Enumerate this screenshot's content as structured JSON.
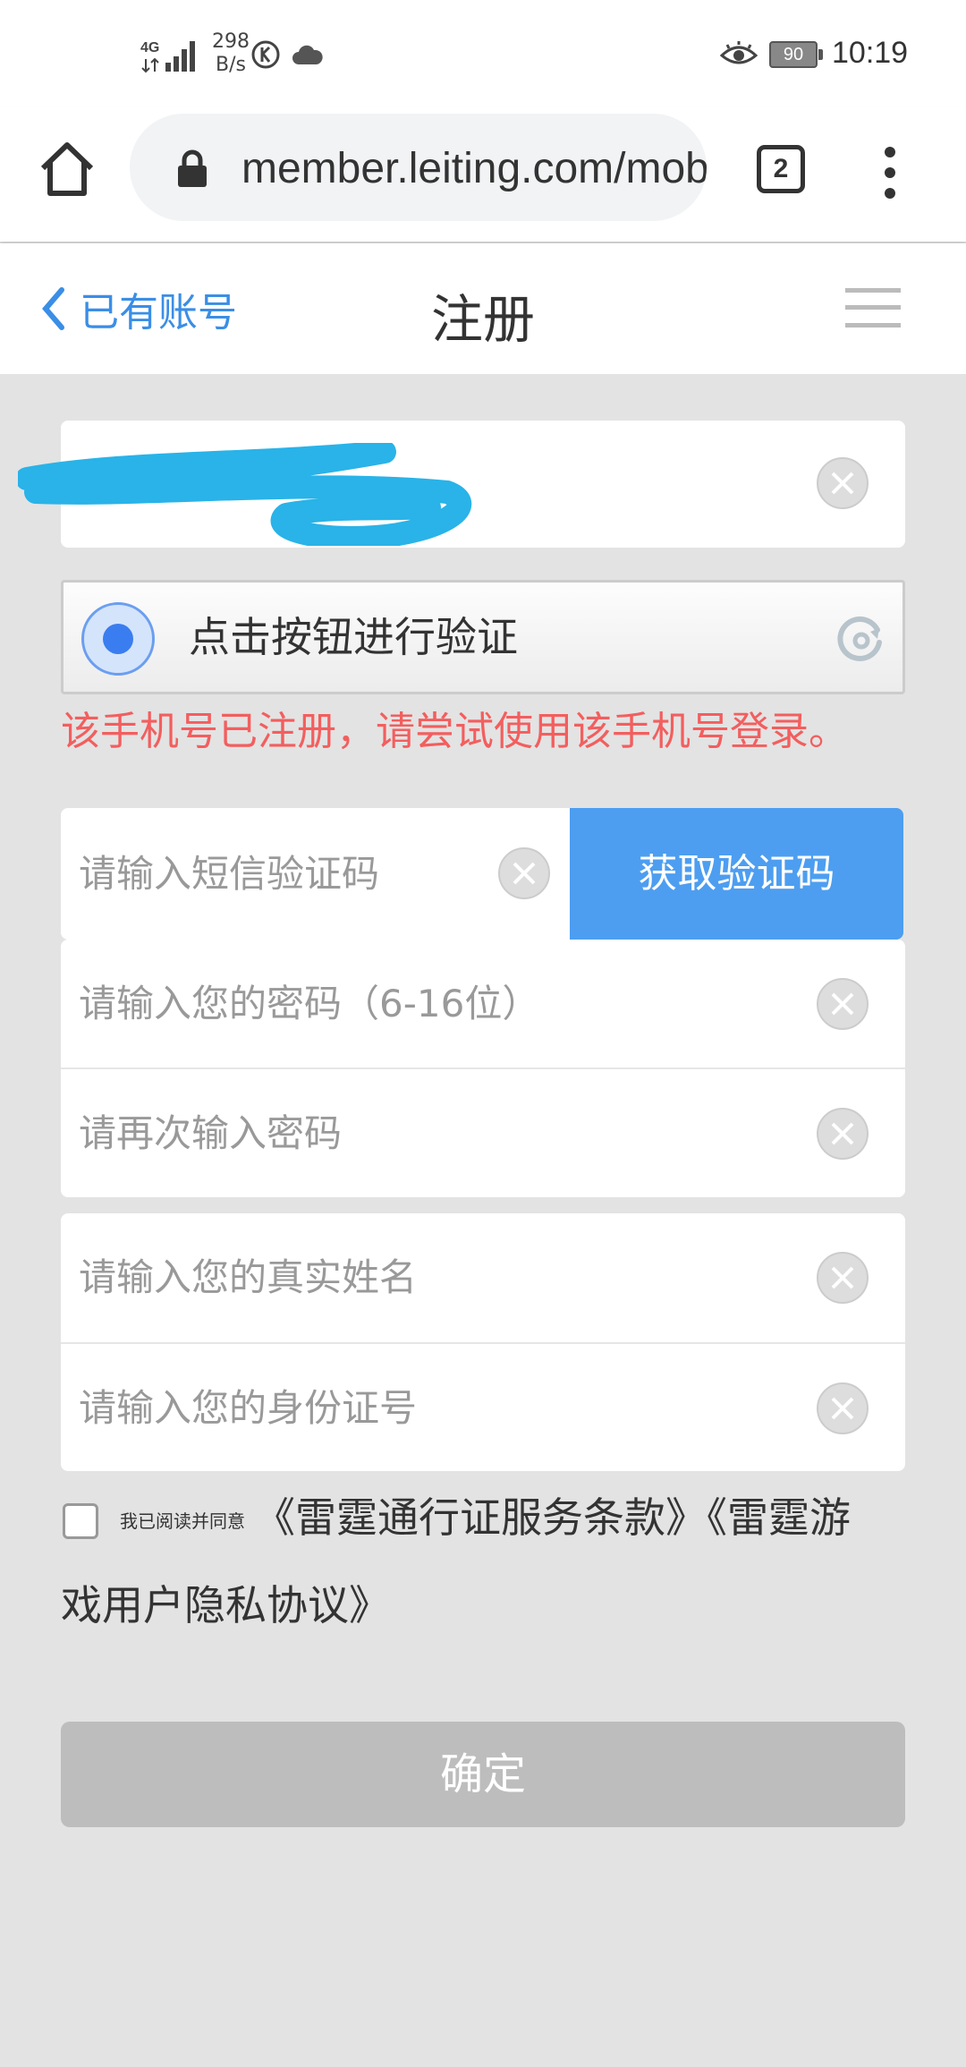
{
  "status_bar": {
    "network": "4G",
    "speed_value": "298",
    "speed_unit": "B/s",
    "battery": "90",
    "time": "10:19"
  },
  "browser": {
    "url": "member.leiting.com/mobile/register",
    "tab_count": "2"
  },
  "header": {
    "back_label": "已有账号",
    "title": "注册"
  },
  "captcha": {
    "label": "点击按钮进行验证"
  },
  "error_message": "该手机号已注册，请尝试使用该手机号登录。",
  "form": {
    "sms_placeholder": "请输入短信验证码",
    "sms_button": "获取验证码",
    "password_placeholder": "请输入您的密码（6-16位）",
    "password_confirm_placeholder": "请再次输入密码",
    "real_name_placeholder": "请输入您的真实姓名",
    "id_number_placeholder": "请输入您的身份证号"
  },
  "agreement": {
    "prefix": "我已阅读并同意",
    "line1": "《雷霆通行证服务条款》《雷霆游",
    "line2": "戏用户隐私协议》"
  },
  "confirm_button": "确定",
  "colors": {
    "accent": "#4d9ef0",
    "error": "#f35e5e",
    "link": "#3a8ee6",
    "disabled_button": "#bdbdbd",
    "scribble": "#29b3e8"
  }
}
